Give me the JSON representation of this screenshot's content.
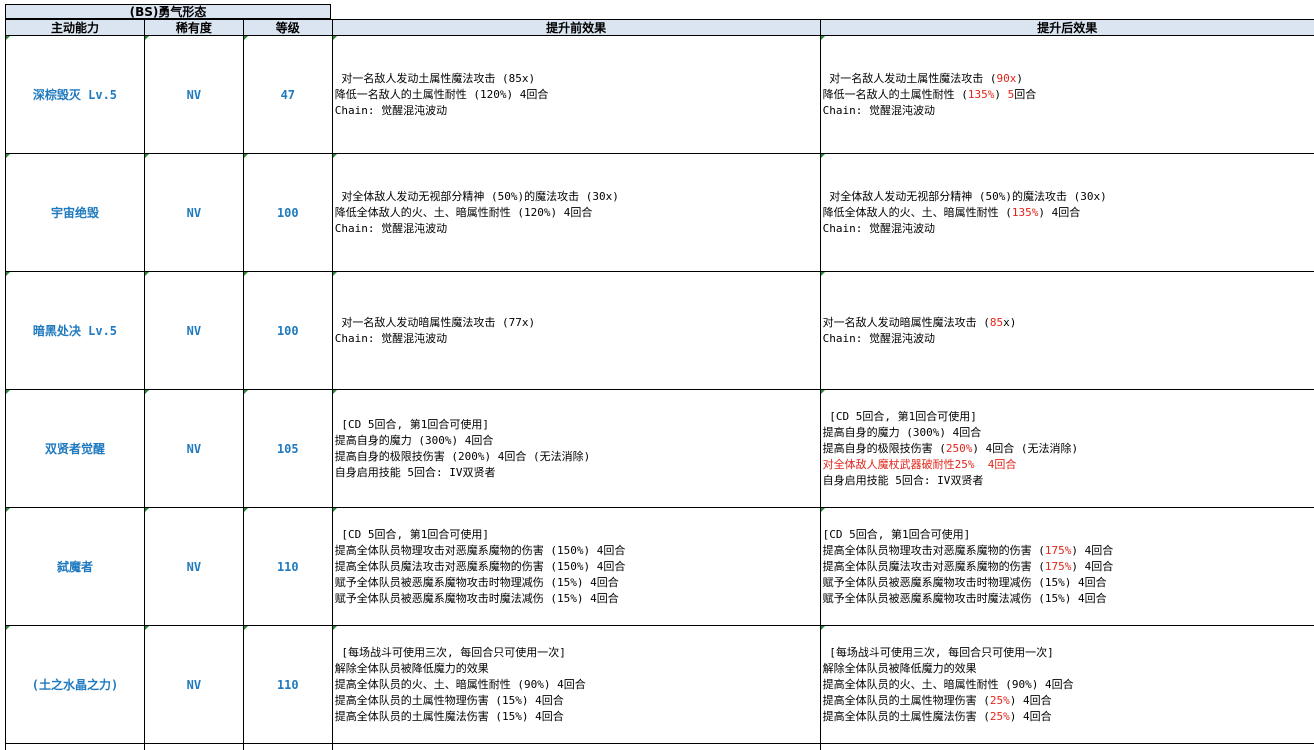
{
  "sheet": {
    "section_title": "(BS)勇气形态",
    "headers": {
      "skill": "主动能力",
      "rarity": "稀有度",
      "level": "等级",
      "before": "提升前效果",
      "after": "提升后效果"
    },
    "rows": [
      {
        "skill": "深棕毁灭 Lv.5",
        "rarity": "NV",
        "level": "47",
        "before": [
          [
            {
              "t": " 对一名敌人发动土属性魔法攻击 (85x)"
            }
          ],
          [
            {
              "t": "降低一名敌人的土属性耐性 (120%) 4回合"
            }
          ],
          [
            {
              "t": "Chain: 觉醒混沌波动"
            }
          ]
        ],
        "after": [
          [
            {
              "t": " 对一名敌人发动土属性魔法攻击 ("
            },
            {
              "t": "90x",
              "red": true
            },
            {
              "t": ")"
            }
          ],
          [
            {
              "t": "降低一名敌人的土属性耐性 ("
            },
            {
              "t": "135%",
              "red": true
            },
            {
              "t": ") "
            },
            {
              "t": "5",
              "red": true
            },
            {
              "t": "回合"
            }
          ],
          [
            {
              "t": "Chain: 觉醒混沌波动"
            }
          ]
        ]
      },
      {
        "skill": "宇宙绝毁",
        "rarity": "NV",
        "level": "100",
        "before": [
          [
            {
              "t": " 对全体敌人发动无视部分精神 (50%)的魔法攻击 (30x)"
            }
          ],
          [
            {
              "t": "降低全体敌人的火、土、暗属性耐性 (120%) 4回合"
            }
          ],
          [
            {
              "t": "Chain: 觉醒混沌波动"
            }
          ]
        ],
        "after": [
          [
            {
              "t": " 对全体敌人发动无视部分精神 (50%)的魔法攻击 (30x)"
            }
          ],
          [
            {
              "t": "降低全体敌人的火、土、暗属性耐性 ("
            },
            {
              "t": "135%",
              "red": true
            },
            {
              "t": ") 4回合"
            }
          ],
          [
            {
              "t": "Chain: 觉醒混沌波动"
            }
          ]
        ]
      },
      {
        "skill": "暗黑处决 Lv.5",
        "rarity": "NV",
        "level": "100",
        "before": [
          [
            {
              "t": " 对一名敌人发动暗属性魔法攻击 (77x)"
            }
          ],
          [
            {
              "t": "Chain: 觉醒混沌波动"
            }
          ]
        ],
        "after": [
          [
            {
              "t": "对一名敌人发动暗属性魔法攻击 ("
            },
            {
              "t": "85",
              "red": true
            },
            {
              "t": "x)"
            }
          ],
          [
            {
              "t": "Chain: 觉醒混沌波动"
            }
          ]
        ]
      },
      {
        "skill": "双贤者觉醒",
        "rarity": "NV",
        "level": "105",
        "before": [
          [
            {
              "t": " [CD 5回合, 第1回合可使用]"
            }
          ],
          [
            {
              "t": "提高自身的魔力 (300%) 4回合"
            }
          ],
          [
            {
              "t": "提高自身的极限技伤害 (200%) 4回合 (无法消除)"
            }
          ],
          [
            {
              "t": "自身启用技能 5回合: IV双贤者"
            }
          ]
        ],
        "after": [
          [
            {
              "t": " [CD 5回合, 第1回合可使用]"
            }
          ],
          [
            {
              "t": "提高自身的魔力 (300%) 4回合"
            }
          ],
          [
            {
              "t": "提高自身的极限技伤害 ("
            },
            {
              "t": "250%",
              "red": true
            },
            {
              "t": ") 4回合 (无法消除)"
            }
          ],
          [
            {
              "t": "对全体敌人魔杖武器破耐性25%  4回合",
              "red": true
            }
          ],
          [
            {
              "t": "自身启用技能 5回合: IV双贤者"
            }
          ]
        ]
      },
      {
        "skill": "弑魔者",
        "rarity": "NV",
        "level": "110",
        "before": [
          [
            {
              "t": " [CD 5回合, 第1回合可使用]"
            }
          ],
          [
            {
              "t": "提高全体队员物理攻击对恶魔系魔物的伤害 (150%) 4回合"
            }
          ],
          [
            {
              "t": "提高全体队员魔法攻击对恶魔系魔物的伤害 (150%) 4回合"
            }
          ],
          [
            {
              "t": "赋予全体队员被恶魔系魔物攻击时物理减伤 (15%) 4回合"
            }
          ],
          [
            {
              "t": "赋予全体队员被恶魔系魔物攻击时魔法减伤 (15%) 4回合"
            }
          ]
        ],
        "after": [
          [
            {
              "t": "[CD 5回合, 第1回合可使用]"
            }
          ],
          [
            {
              "t": "提高全体队员物理攻击对恶魔系魔物的伤害 ("
            },
            {
              "t": "175%",
              "red": true
            },
            {
              "t": ") 4回合"
            }
          ],
          [
            {
              "t": "提高全体队员魔法攻击对恶魔系魔物的伤害 ("
            },
            {
              "t": "175%",
              "red": true
            },
            {
              "t": ") 4回合"
            }
          ],
          [
            {
              "t": "赋予全体队员被恶魔系魔物攻击时物理减伤 (15%) 4回合"
            }
          ],
          [
            {
              "t": "赋予全体队员被恶魔系魔物攻击时魔法减伤 (15%) 4回合"
            }
          ]
        ]
      },
      {
        "skill": "(土之水晶之力)",
        "rarity": "NV",
        "level": "110",
        "before": [
          [
            {
              "t": " [每场战斗可使用三次, 每回合只可使用一次]"
            }
          ],
          [
            {
              "t": "解除全体队员被降低魔力的效果"
            }
          ],
          [
            {
              "t": "提高全体队员的火、土、暗属性耐性 (90%) 4回合"
            }
          ],
          [
            {
              "t": "提高全体队员的土属性物理伤害 (15%) 4回合"
            }
          ],
          [
            {
              "t": "提高全体队员的土属性魔法伤害 (15%) 4回合"
            }
          ]
        ],
        "after": [
          [
            {
              "t": " [每场战斗可使用三次, 每回合只可使用一次]"
            }
          ],
          [
            {
              "t": "解除全体队员被降低魔力的效果"
            }
          ],
          [
            {
              "t": "提高全体队员的火、土、暗属性耐性 (90%) 4回合"
            }
          ],
          [
            {
              "t": "提高全体队员的土属性物理伤害 ("
            },
            {
              "t": "25%",
              "red": true
            },
            {
              "t": ") 4回合"
            }
          ],
          [
            {
              "t": "提高全体队员的土属性魔法伤害 ("
            },
            {
              "t": "25%",
              "red": true
            },
            {
              "t": ") 4回合"
            }
          ]
        ]
      }
    ]
  },
  "colors": {
    "header_bg": "#dbe5f1",
    "skill_text": "#1f7abf",
    "highlight_red": "#e0251b",
    "comment_marker": "#2a8a3a"
  }
}
